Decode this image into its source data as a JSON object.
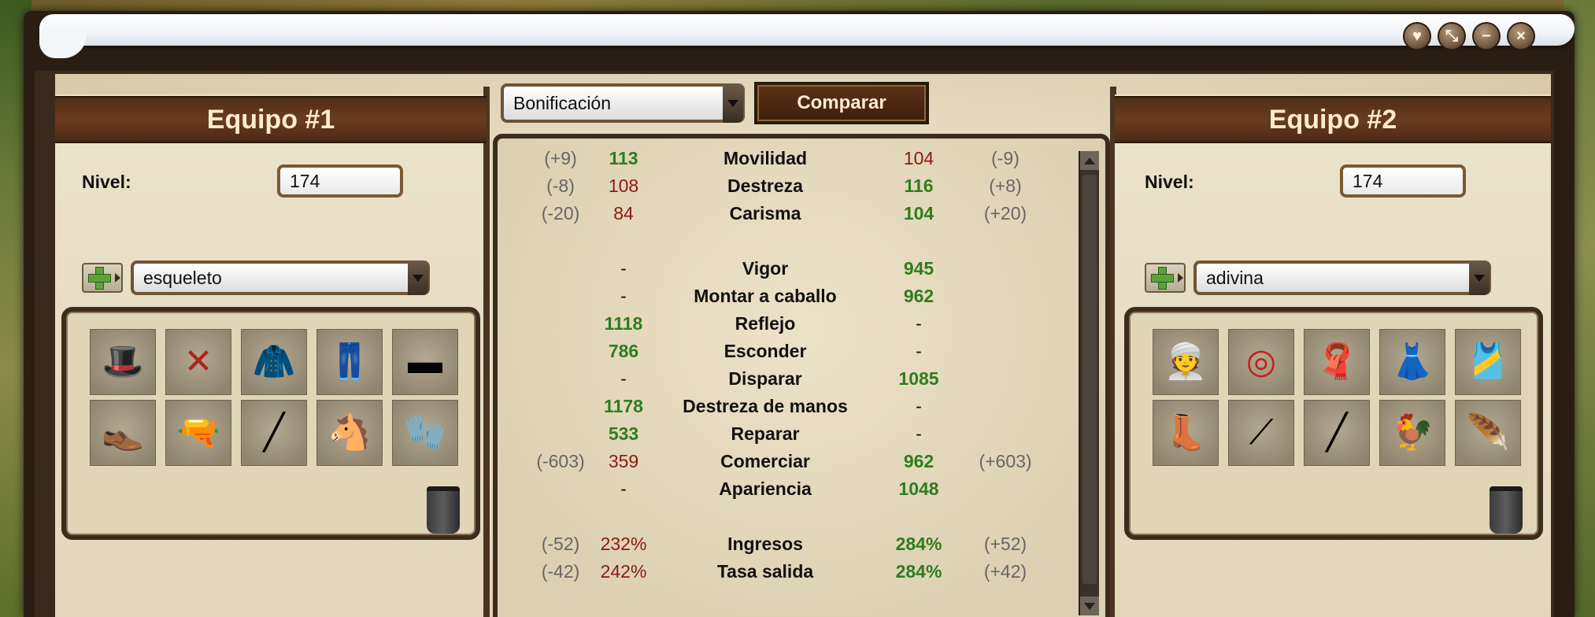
{
  "window": {
    "controls": [
      "favorite-icon",
      "minimize-to-tray-icon",
      "minimize-icon",
      "close-icon"
    ]
  },
  "toolbar": {
    "sort_select_value": "Bonificación",
    "compare_label": "Comparar"
  },
  "team1": {
    "title": "Equipo #1",
    "level_label": "Nivel:",
    "level_value": "174",
    "set_select_value": "esqueleto",
    "items": [
      "top-hat",
      "red-scarf",
      "black-tailcoat",
      "skeleton-pants",
      "black-belt",
      "black-shoes",
      "revolver",
      "rifle",
      "skeleton-horse",
      "skeleton-gloves"
    ]
  },
  "team2": {
    "title": "Equipo #2",
    "level_label": "Nivel:",
    "level_value": "174",
    "set_select_value": "adivina",
    "items": [
      "turban",
      "red-bead-necklace",
      "head-scarf",
      "black-skirt",
      "black-corset",
      "brown-boots",
      "compass-tool",
      "thin-staff",
      "rooster",
      "quill-feather"
    ]
  },
  "stats": [
    {
      "name": "Movilidad",
      "t1_diff": "(+9)",
      "t1_value": "113",
      "t1_status": "green",
      "t2_value": "104",
      "t2_status": "red",
      "t2_diff": "(-9)"
    },
    {
      "name": "Destreza",
      "t1_diff": "(-8)",
      "t1_value": "108",
      "t1_status": "red",
      "t2_value": "116",
      "t2_status": "green",
      "t2_diff": "(+8)"
    },
    {
      "name": "Carisma",
      "t1_diff": "(-20)",
      "t1_value": "84",
      "t1_status": "red",
      "t2_value": "104",
      "t2_status": "green",
      "t2_diff": "(+20)"
    },
    {
      "name": "",
      "t1_diff": "",
      "t1_value": "",
      "t1_status": "neutral",
      "t2_value": "",
      "t2_status": "neutral",
      "t2_diff": ""
    },
    {
      "name": "Vigor",
      "t1_diff": "",
      "t1_value": "-",
      "t1_status": "neutral",
      "t2_value": "945",
      "t2_status": "green",
      "t2_diff": ""
    },
    {
      "name": "Montar a caballo",
      "t1_diff": "",
      "t1_value": "-",
      "t1_status": "neutral",
      "t2_value": "962",
      "t2_status": "green",
      "t2_diff": ""
    },
    {
      "name": "Reflejo",
      "t1_diff": "",
      "t1_value": "1118",
      "t1_status": "green",
      "t2_value": "-",
      "t2_status": "neutral",
      "t2_diff": ""
    },
    {
      "name": "Esconder",
      "t1_diff": "",
      "t1_value": "786",
      "t1_status": "green",
      "t2_value": "-",
      "t2_status": "neutral",
      "t2_diff": ""
    },
    {
      "name": "Disparar",
      "t1_diff": "",
      "t1_value": "-",
      "t1_status": "neutral",
      "t2_value": "1085",
      "t2_status": "green",
      "t2_diff": ""
    },
    {
      "name": "Destreza de manos",
      "t1_diff": "",
      "t1_value": "1178",
      "t1_status": "green",
      "t2_value": "-",
      "t2_status": "neutral",
      "t2_diff": ""
    },
    {
      "name": "Reparar",
      "t1_diff": "",
      "t1_value": "533",
      "t1_status": "green",
      "t2_value": "-",
      "t2_status": "neutral",
      "t2_diff": ""
    },
    {
      "name": "Comerciar",
      "t1_diff": "(-603)",
      "t1_value": "359",
      "t1_status": "red",
      "t2_value": "962",
      "t2_status": "green",
      "t2_diff": "(+603)"
    },
    {
      "name": "Apariencia",
      "t1_diff": "",
      "t1_value": "-",
      "t1_status": "neutral",
      "t2_value": "1048",
      "t2_status": "green",
      "t2_diff": ""
    },
    {
      "name": "",
      "t1_diff": "",
      "t1_value": "",
      "t1_status": "neutral",
      "t2_value": "",
      "t2_status": "neutral",
      "t2_diff": ""
    },
    {
      "name": "Ingresos",
      "t1_diff": "(-52)",
      "t1_value": "232%",
      "t1_status": "red",
      "t2_value": "284%",
      "t2_status": "green",
      "t2_diff": "(+52)"
    },
    {
      "name": "Tasa salida",
      "t1_diff": "(-42)",
      "t1_value": "242%",
      "t1_status": "red",
      "t2_value": "284%",
      "t2_status": "green",
      "t2_diff": "(+42)"
    }
  ],
  "colors": {
    "better": "#2e7d1e",
    "worse": "#8b1a10",
    "diff": "#666666",
    "header_bg": "#5a3219",
    "header_text": "#ffeccc"
  }
}
